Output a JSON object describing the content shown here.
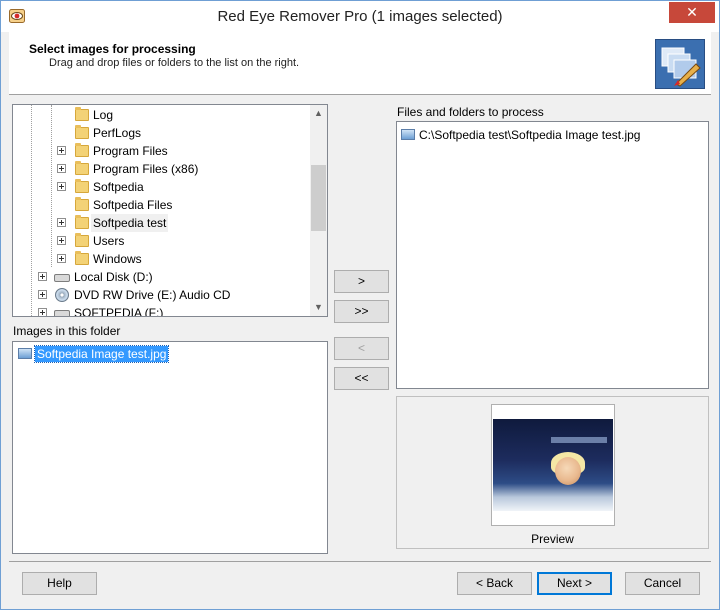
{
  "window": {
    "title": "Red Eye Remover Pro (1 images selected)",
    "close_glyph": "✕",
    "app_icon": "red-eye-app-icon"
  },
  "header": {
    "title": "Select images for processing",
    "subtitle": "Drag and drop files or folders to the list on the right.",
    "icon": "image-edit-icon"
  },
  "tree": {
    "items": [
      {
        "label": "Log",
        "type": "folder",
        "expandable": false
      },
      {
        "label": "PerfLogs",
        "type": "folder",
        "expandable": false
      },
      {
        "label": "Program Files",
        "type": "folder",
        "expandable": true
      },
      {
        "label": "Program Files (x86)",
        "type": "folder",
        "expandable": true
      },
      {
        "label": "Softpedia",
        "type": "folder",
        "expandable": true
      },
      {
        "label": "Softpedia Files",
        "type": "folder",
        "expandable": false
      },
      {
        "label": "Softpedia test",
        "type": "folder",
        "expandable": true,
        "selected": true
      },
      {
        "label": "Users",
        "type": "folder",
        "expandable": true
      },
      {
        "label": "Windows",
        "type": "folder",
        "expandable": true
      },
      {
        "label": "Local Disk (D:)",
        "type": "drive",
        "expandable": true
      },
      {
        "label": "DVD RW Drive (E:) Audio CD",
        "type": "cd",
        "expandable": true
      },
      {
        "label": "SOFTPEDIA (F:)",
        "type": "drive",
        "expandable": true
      }
    ]
  },
  "images_folder": {
    "label": "Images in this folder",
    "items": [
      {
        "label": "Softpedia Image test.jpg",
        "selected": true
      }
    ]
  },
  "process_list": {
    "label": "Files and folders to process",
    "items": [
      {
        "label": "C:\\Softpedia test\\Softpedia Image test.jpg"
      }
    ]
  },
  "transfer_buttons": {
    "add": ">",
    "add_all": ">>",
    "remove": "<",
    "remove_all": "<<"
  },
  "preview": {
    "caption": "Preview"
  },
  "footer": {
    "help": "Help",
    "back": "< Back",
    "next": "Next >",
    "cancel": "Cancel"
  },
  "colors": {
    "selection": "#3399ff",
    "close_button": "#c7483a",
    "window_border": "#6f9fd4"
  }
}
